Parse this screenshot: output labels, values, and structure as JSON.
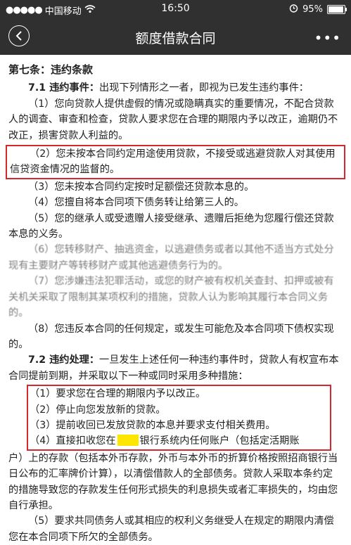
{
  "status_bar": {
    "carrier": "中国移动",
    "time": "16:50",
    "battery": "95%",
    "battery_level": 0.95
  },
  "nav": {
    "title": "额度借款合同",
    "more": "•••"
  },
  "article": {
    "heading": "第七条：违约条款",
    "s71_label": "7.1 违约事件：",
    "s71_text": "出现下列情形之一者，即视为已发生违约事件：",
    "s71_item1": "（1）您向贷款人提供虚假的情况或隐瞒真实的重要情况，不配合贷款人的调查、审查和检查，贷款人要求您在合理的期限内予以改正，逾期仍不改正，损害贷款人利益的。",
    "s71_item2": "（2）您未按本合同约定用途使用贷款，不接受或逃避贷款人对其使用信贷资金情况的监督的。",
    "s71_item3": "（3）您未按本合同约定按时足额偿还贷款本息的。",
    "s71_item4": "（4）您擅自将本合同项下债务转让给第三人的。",
    "s71_item5": "（5）您的继承人或受遗赠人接受继承、遗赠后拒绝为您履行偿还贷款本息的义务。",
    "s71_item6": "（6）您转移财产、抽逃资金，以逃避债务或者以其他不适当方式处分现有主要财产等转移财产或其他逃避债务行为的。",
    "s71_item7": "（7）您涉嫌违法犯罪活动，或您的财产被有权机关查封、扣押或被有关机关采取了限制其某项权利的措施，贷款人认为影响其履行本合同义务的。",
    "s71_item8": "（8）您违反本合同的任何规定，或发生可能危及本合同项下债权实现的。",
    "s72_label": "7.2 违约处理：",
    "s72_text": "一旦发生上述任何一种违约事件时，贷款人有权宣布本合同提前到期，并采取以下一种或同时采用多种措施：",
    "s72_item1": "（1）要求您在合理的期限内予以改正。",
    "s72_item2": "（2）停止向您发放新的贷款。",
    "s72_item3": "（3）提前收回已发放贷款的本息并要求支付相关费用。",
    "s72_item4_a": "（4）直接扣收您在",
    "s72_item4_b": "银行系统内任何账户（包括定活期账",
    "s72_item4_cont": "户）上的存款（包括本外币存款，外币与本外币的折算价格按照招商银行当日公布的汇率牌价计算），以清偿借款人的全部债务。贷款人采取本条约定的措施导致您的存款发生任何形式损失的利息损失或者汇率损失的，均由您自行承担。",
    "s72_item5": "（5）要求共同债务人或其相应的权利义务继受人在规定的期限内清偿您在本合同项下所欠的全部债务。"
  },
  "colors": {
    "bar_bg": "#303030",
    "highlight_box": "#d6282c",
    "redaction": "#ffe600"
  }
}
